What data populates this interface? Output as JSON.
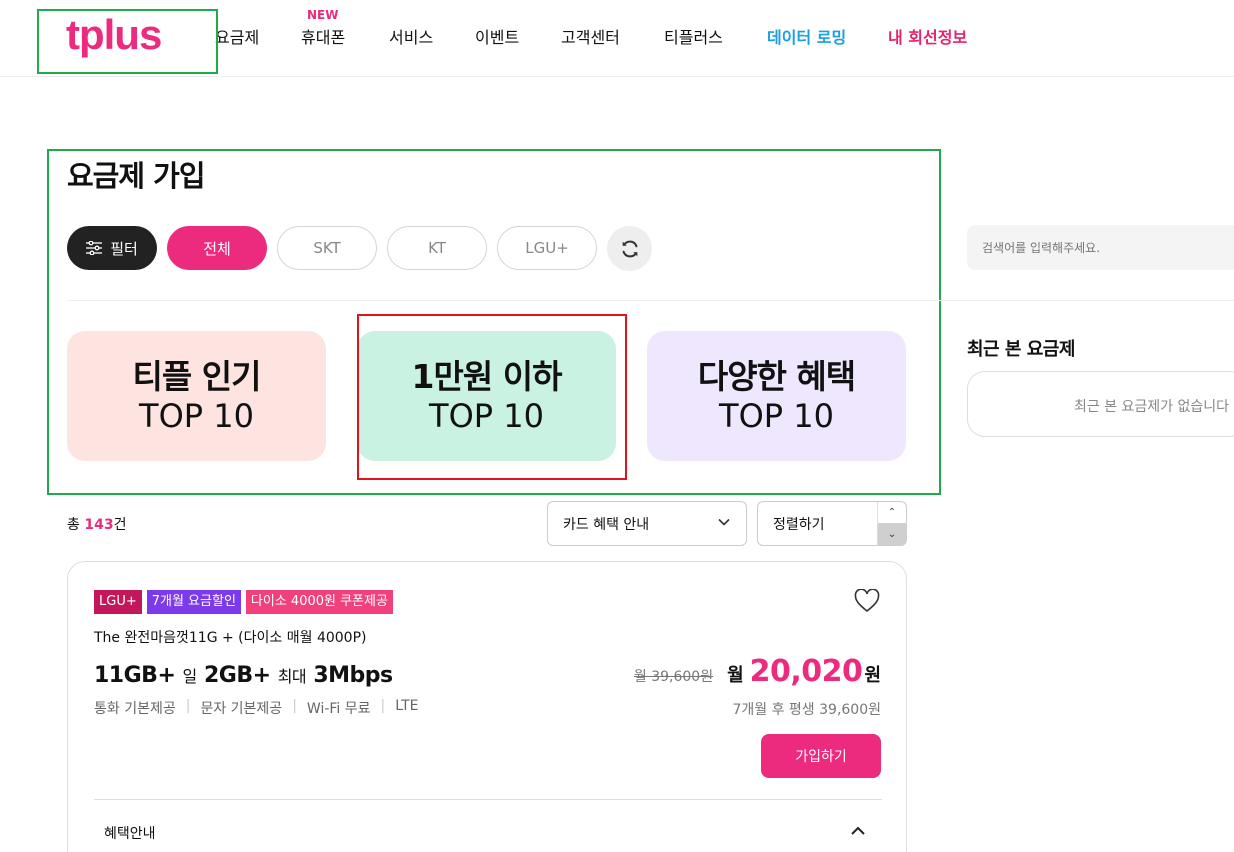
{
  "header": {
    "logo": "tplus",
    "nav": [
      {
        "label": "요금제",
        "badge": ""
      },
      {
        "label": "휴대폰",
        "badge": "NEW"
      },
      {
        "label": "서비스",
        "badge": ""
      },
      {
        "label": "이벤트",
        "badge": ""
      },
      {
        "label": "고객센터",
        "badge": ""
      },
      {
        "label": "티플러스",
        "badge": ""
      },
      {
        "label": "데이터 로밍",
        "badge": ""
      },
      {
        "label": "내 회선정보",
        "badge": ""
      }
    ]
  },
  "page": {
    "title": "요금제 가입"
  },
  "filters": {
    "filter_label": "필터",
    "chips": [
      "전체",
      "SKT",
      "KT",
      "LGU+"
    ]
  },
  "top_cards": [
    {
      "line1": "티플 인기",
      "line2": "TOP 10",
      "bg": "#fde4e1"
    },
    {
      "line1": "1만원 이하",
      "line2": "TOP 10",
      "bg": "#c9f2e3"
    },
    {
      "line1": "다양한 혜택",
      "line2": "TOP 10",
      "bg": "#efe7fe"
    }
  ],
  "sidebar": {
    "search_placeholder": "검색어를 입력해주세요.",
    "recent_title": "최근 본 요금제",
    "recent_empty": "최근 본 요금제가 없습니다"
  },
  "list": {
    "total_prefix": "총 ",
    "total_count": "143",
    "total_suffix": "건",
    "card_select": "카드 혜택 안내",
    "sort_select": "정렬하기"
  },
  "plan": {
    "badges": [
      {
        "label": "LGU+",
        "color": "#c2185b"
      },
      {
        "label": "7개월 요금할인",
        "color": "#7c3aed"
      },
      {
        "label": "다이소 4000원 쿠폰제공",
        "color": "#f0417c"
      }
    ],
    "name": "The 완전마음껏11G + (다이소 매월 4000P)",
    "data_main": "11GB+",
    "data_day_label": "일",
    "data_day": "2GB+",
    "data_max_label": "최대",
    "data_speed": "3Mbps",
    "features": [
      "통화 기본제공",
      "문자 기본제공",
      "Wi-Fi 무료",
      "LTE"
    ],
    "old_price": "월 39,600원",
    "month_label": "월",
    "price": "20,020",
    "won": "원",
    "after_price": "7개월 후 평생 39,600원",
    "join_label": "가입하기",
    "benefit_label": "혜택안내"
  },
  "colors": {
    "accent": "#ec2a7e",
    "roaming": "#1a9fe0",
    "my_line": "#e6236f",
    "highlight_green": "#1faa4c",
    "highlight_red": "#e0141e"
  }
}
